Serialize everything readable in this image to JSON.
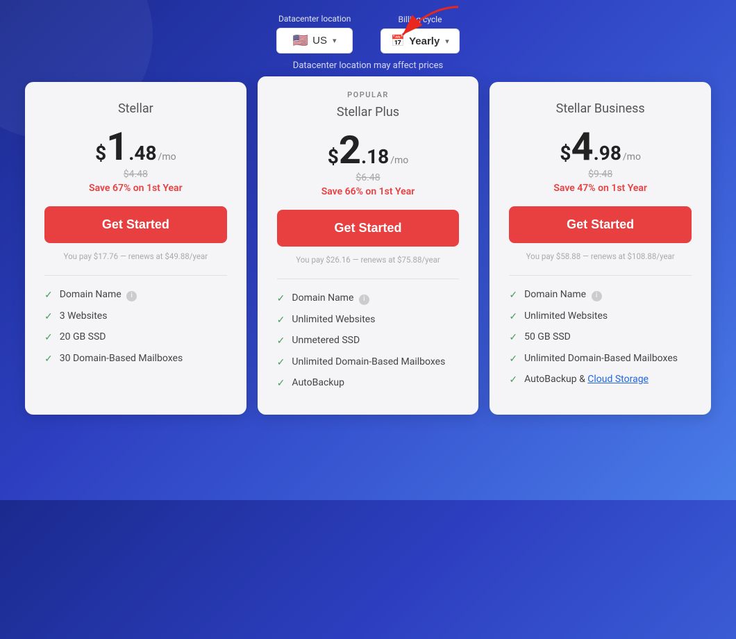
{
  "header": {
    "datacenter_label": "Datacenter location",
    "billing_label": "Billing cycle",
    "location": "US",
    "billing_cycle": "Yearly",
    "note": "Datacenter location may affect prices"
  },
  "plans": [
    {
      "id": "stellar",
      "popular": false,
      "popular_label": "",
      "name": "Stellar",
      "price_dollar": "$",
      "price_whole": "1",
      "price_decimal": ".48",
      "price_period": "/mo",
      "original_price": "$4.48",
      "save_text": "Save 67% on 1st Year",
      "btn_label": "Get Started",
      "renew_note": "You pay $17.76 — renews at $49.88/year",
      "features": [
        {
          "text": "Domain Name",
          "has_info": true,
          "link": null
        },
        {
          "text": "3 Websites",
          "has_info": false,
          "link": null
        },
        {
          "text": "20 GB SSD",
          "has_info": false,
          "link": null
        },
        {
          "text": "30 Domain-Based Mailboxes",
          "has_info": false,
          "link": null
        }
      ]
    },
    {
      "id": "stellar-plus",
      "popular": true,
      "popular_label": "POPULAR",
      "name": "Stellar Plus",
      "price_dollar": "$",
      "price_whole": "2",
      "price_decimal": ".18",
      "price_period": "/mo",
      "original_price": "$6.48",
      "save_text": "Save 66% on 1st Year",
      "btn_label": "Get Started",
      "renew_note": "You pay $26.16 — renews at $75.88/year",
      "features": [
        {
          "text": "Domain Name",
          "has_info": true,
          "link": null
        },
        {
          "text": "Unlimited Websites",
          "has_info": false,
          "link": null
        },
        {
          "text": "Unmetered SSD",
          "has_info": false,
          "link": null
        },
        {
          "text": "Unlimited Domain-Based Mailboxes",
          "has_info": false,
          "link": null
        },
        {
          "text": "AutoBackup",
          "has_info": false,
          "link": null
        }
      ]
    },
    {
      "id": "stellar-business",
      "popular": false,
      "popular_label": "",
      "name": "Stellar Business",
      "price_dollar": "$",
      "price_whole": "4",
      "price_decimal": ".98",
      "price_period": "/mo",
      "original_price": "$9.48",
      "save_text": "Save 47% on 1st Year",
      "btn_label": "Get Started",
      "renew_note": "You pay $58.88 — renews at $108.88/year",
      "features": [
        {
          "text": "Domain Name",
          "has_info": true,
          "link": null
        },
        {
          "text": "Unlimited Websites",
          "has_info": false,
          "link": null
        },
        {
          "text": "50 GB SSD",
          "has_info": false,
          "link": null
        },
        {
          "text": "Unlimited Domain-Based Mailboxes",
          "has_info": false,
          "link": null
        },
        {
          "text": "AutoBackup & ",
          "has_info": false,
          "link": "Cloud Storage"
        }
      ]
    }
  ]
}
